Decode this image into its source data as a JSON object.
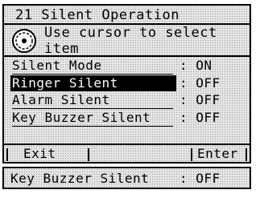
{
  "screen": {
    "title": "21 Silent Operation",
    "hint_line_1": "Use cursor to select",
    "hint_line_2": "item",
    "info_icon": "info-icon"
  },
  "menu": {
    "items": [
      {
        "label": "Silent Mode",
        "value": ": ON",
        "selected": false
      },
      {
        "label": "Ringer Silent",
        "value": ": OFF",
        "selected": true
      },
      {
        "label": "Alarm Silent",
        "value": ": OFF",
        "selected": false
      },
      {
        "label": "Key Buzzer Silent",
        "value": ": OFF",
        "selected": false
      }
    ]
  },
  "softkeys": {
    "left": "Exit",
    "middle": "",
    "right": "Enter"
  },
  "status_bar": {
    "label": "Key Buzzer Silent",
    "value": ": OFF"
  },
  "colors": {
    "lcd_background": "#e6e6e6",
    "text": "#000000",
    "selection_background": "#000000",
    "selection_text": "#ffffff"
  }
}
